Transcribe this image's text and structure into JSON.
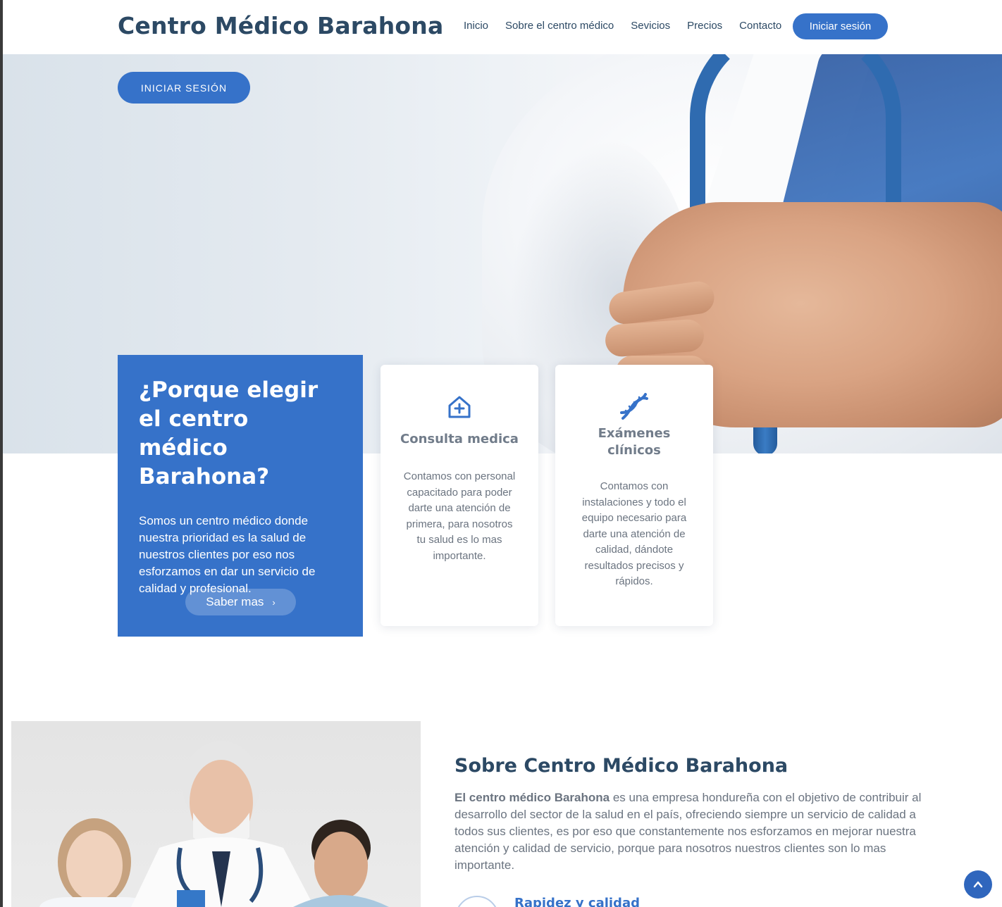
{
  "header": {
    "logo": "Centro Médico Barahona",
    "nav": [
      "Inicio",
      "Sobre el centro médico",
      "Sevicios",
      "Precios",
      "Contacto"
    ],
    "login_button": "Iniciar sesión"
  },
  "hero": {
    "login_button": "INICIAR SESIÓN"
  },
  "why": {
    "title": "¿Porque elegir el centro médico Barahona?",
    "text": "Somos un centro médico donde nuestra prioridad es la salud de nuestros clientes por eso nos esforzamos en dar un servicio de calidad y profesional.",
    "button": "Saber mas"
  },
  "cards": [
    {
      "icon": "hospital-plus-icon",
      "title": "Consulta medica",
      "text": "Contamos con personal capacitado para poder darte una atención de primera, para nosotros tu salud es lo mas importante."
    },
    {
      "icon": "dna-icon",
      "title": "Exámenes clínicos",
      "text": "Contamos con instalaciones y todo el equipo necesario para darte una atención de calidad, dándote resultados precisos y rápidos."
    }
  ],
  "about": {
    "title": "Sobre Centro Médico Barahona",
    "text_bold": "El centro médico Barahona",
    "text_rest": " es una empresa hondureña con el objetivo de contribuir al desarrollo del sector de la salud en el país, ofreciendo siempre un servicio de calidad a todos sus clientes, es por eso que constantemente nos esforzamos en mejorar nuestra atención y calidad de servicio, porque para nosotros nuestros clientes son lo mas importante.",
    "feature_title": "Rapidez y calidad"
  },
  "colors": {
    "primary": "#3672c9",
    "heading": "#2c4964",
    "text": "#6b7480"
  }
}
